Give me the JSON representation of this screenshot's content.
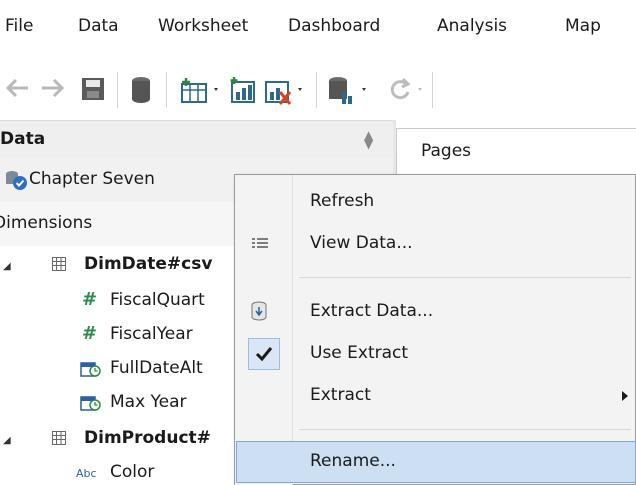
{
  "menubar": {
    "items": [
      "File",
      "Data",
      "Worksheet",
      "Dashboard",
      "Analysis",
      "Map"
    ]
  },
  "toolbar": {
    "icons": [
      "back-arrow-icon",
      "forward-arrow-icon",
      "save-icon",
      "data-source-icon",
      "new-worksheet-icon",
      "new-dashboard-icon",
      "clear-sheet-icon",
      "connect-data-icon",
      "refresh-icon"
    ]
  },
  "data_pane": {
    "title": "Data",
    "source_name": "Chapter Seven",
    "dimensions_label": "Dimensions",
    "fields": [
      {
        "label": "DimDate#csv",
        "bold": true,
        "kind": "table"
      },
      {
        "label": "FiscalQuart",
        "bold": false,
        "kind": "number"
      },
      {
        "label": "FiscalYear",
        "bold": false,
        "kind": "number"
      },
      {
        "label": "FullDateAlt",
        "bold": false,
        "kind": "calc"
      },
      {
        "label": "Max Year",
        "bold": false,
        "kind": "calc"
      },
      {
        "label": "DimProduct#",
        "bold": true,
        "kind": "table"
      },
      {
        "label": "Color",
        "bold": false,
        "kind": "string"
      }
    ],
    "abc_glyph": "Abc",
    "hash_glyph": "#"
  },
  "pages_shelf": {
    "label": "Pages"
  },
  "context_menu": {
    "items": [
      {
        "label": "Refresh"
      },
      {
        "label": "View Data..."
      },
      {
        "label": "Extract Data..."
      },
      {
        "label": "Use Extract",
        "checked": true
      },
      {
        "label": "Extract",
        "submenu": true
      },
      {
        "label": "Rename...",
        "highlighted": true
      }
    ]
  },
  "colors": {
    "highlight": "#cde0f3",
    "pane_header": "#efefef",
    "number_green": "#2a8c4a",
    "string_blue": "#2b5fa6"
  }
}
